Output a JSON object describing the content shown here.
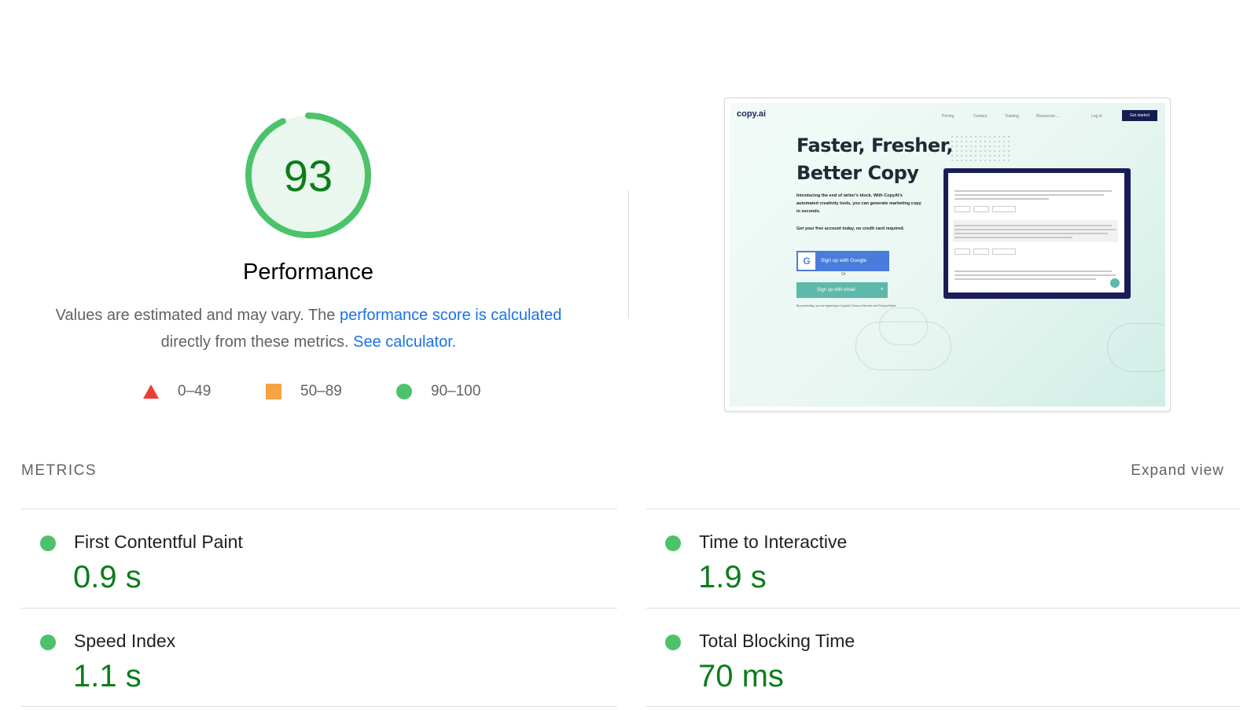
{
  "score": {
    "value": 93,
    "fraction": 0.93,
    "title": "Performance",
    "color": "#0c7d1b",
    "ring_color": "#4cc36a",
    "bg_color": "#eaf7ee"
  },
  "description": {
    "text_before": "Values are estimated and may vary. The ",
    "score_link": "performance score is calculated",
    "text_middle": "directly from these metrics.",
    "calc_link": "See calculator."
  },
  "legend": [
    {
      "range": "0–49",
      "shape": "triangle",
      "color": "#eb3f36"
    },
    {
      "range": "50–89",
      "shape": "square",
      "color": "#f6a342"
    },
    {
      "range": "90–100",
      "shape": "circle",
      "color": "#4cc36a"
    }
  ],
  "screenshot": {
    "logo": "copy.ai",
    "nav": [
      "Pricing",
      "Contact",
      "Training",
      "Resources ⌄",
      "Log in"
    ],
    "cta": "Get started",
    "headline_line1": "Faster, Fresher,",
    "headline_line2": "Better Copy",
    "intro": "Introducing the end of writer's block. With CopyAI's automated creativity tools, you can generate marketing copy in seconds.",
    "signup_note": "Get your free account today, no credit card required.",
    "google_button": "Sign up with Google",
    "or_text": "Or",
    "email_button": "Sign up with email",
    "legal": "By proceeding, you are agreeing to CopyAI's Terms of Service and Privacy Notice"
  },
  "metrics_section": {
    "title": "METRICS",
    "expand": "Expand view",
    "items": [
      {
        "name": "First Contentful Paint",
        "value": "0.9 s"
      },
      {
        "name": "Time to Interactive",
        "value": "1.9 s"
      },
      {
        "name": "Speed Index",
        "value": "1.1 s"
      },
      {
        "name": "Total Blocking Time",
        "value": "70 ms"
      }
    ]
  }
}
